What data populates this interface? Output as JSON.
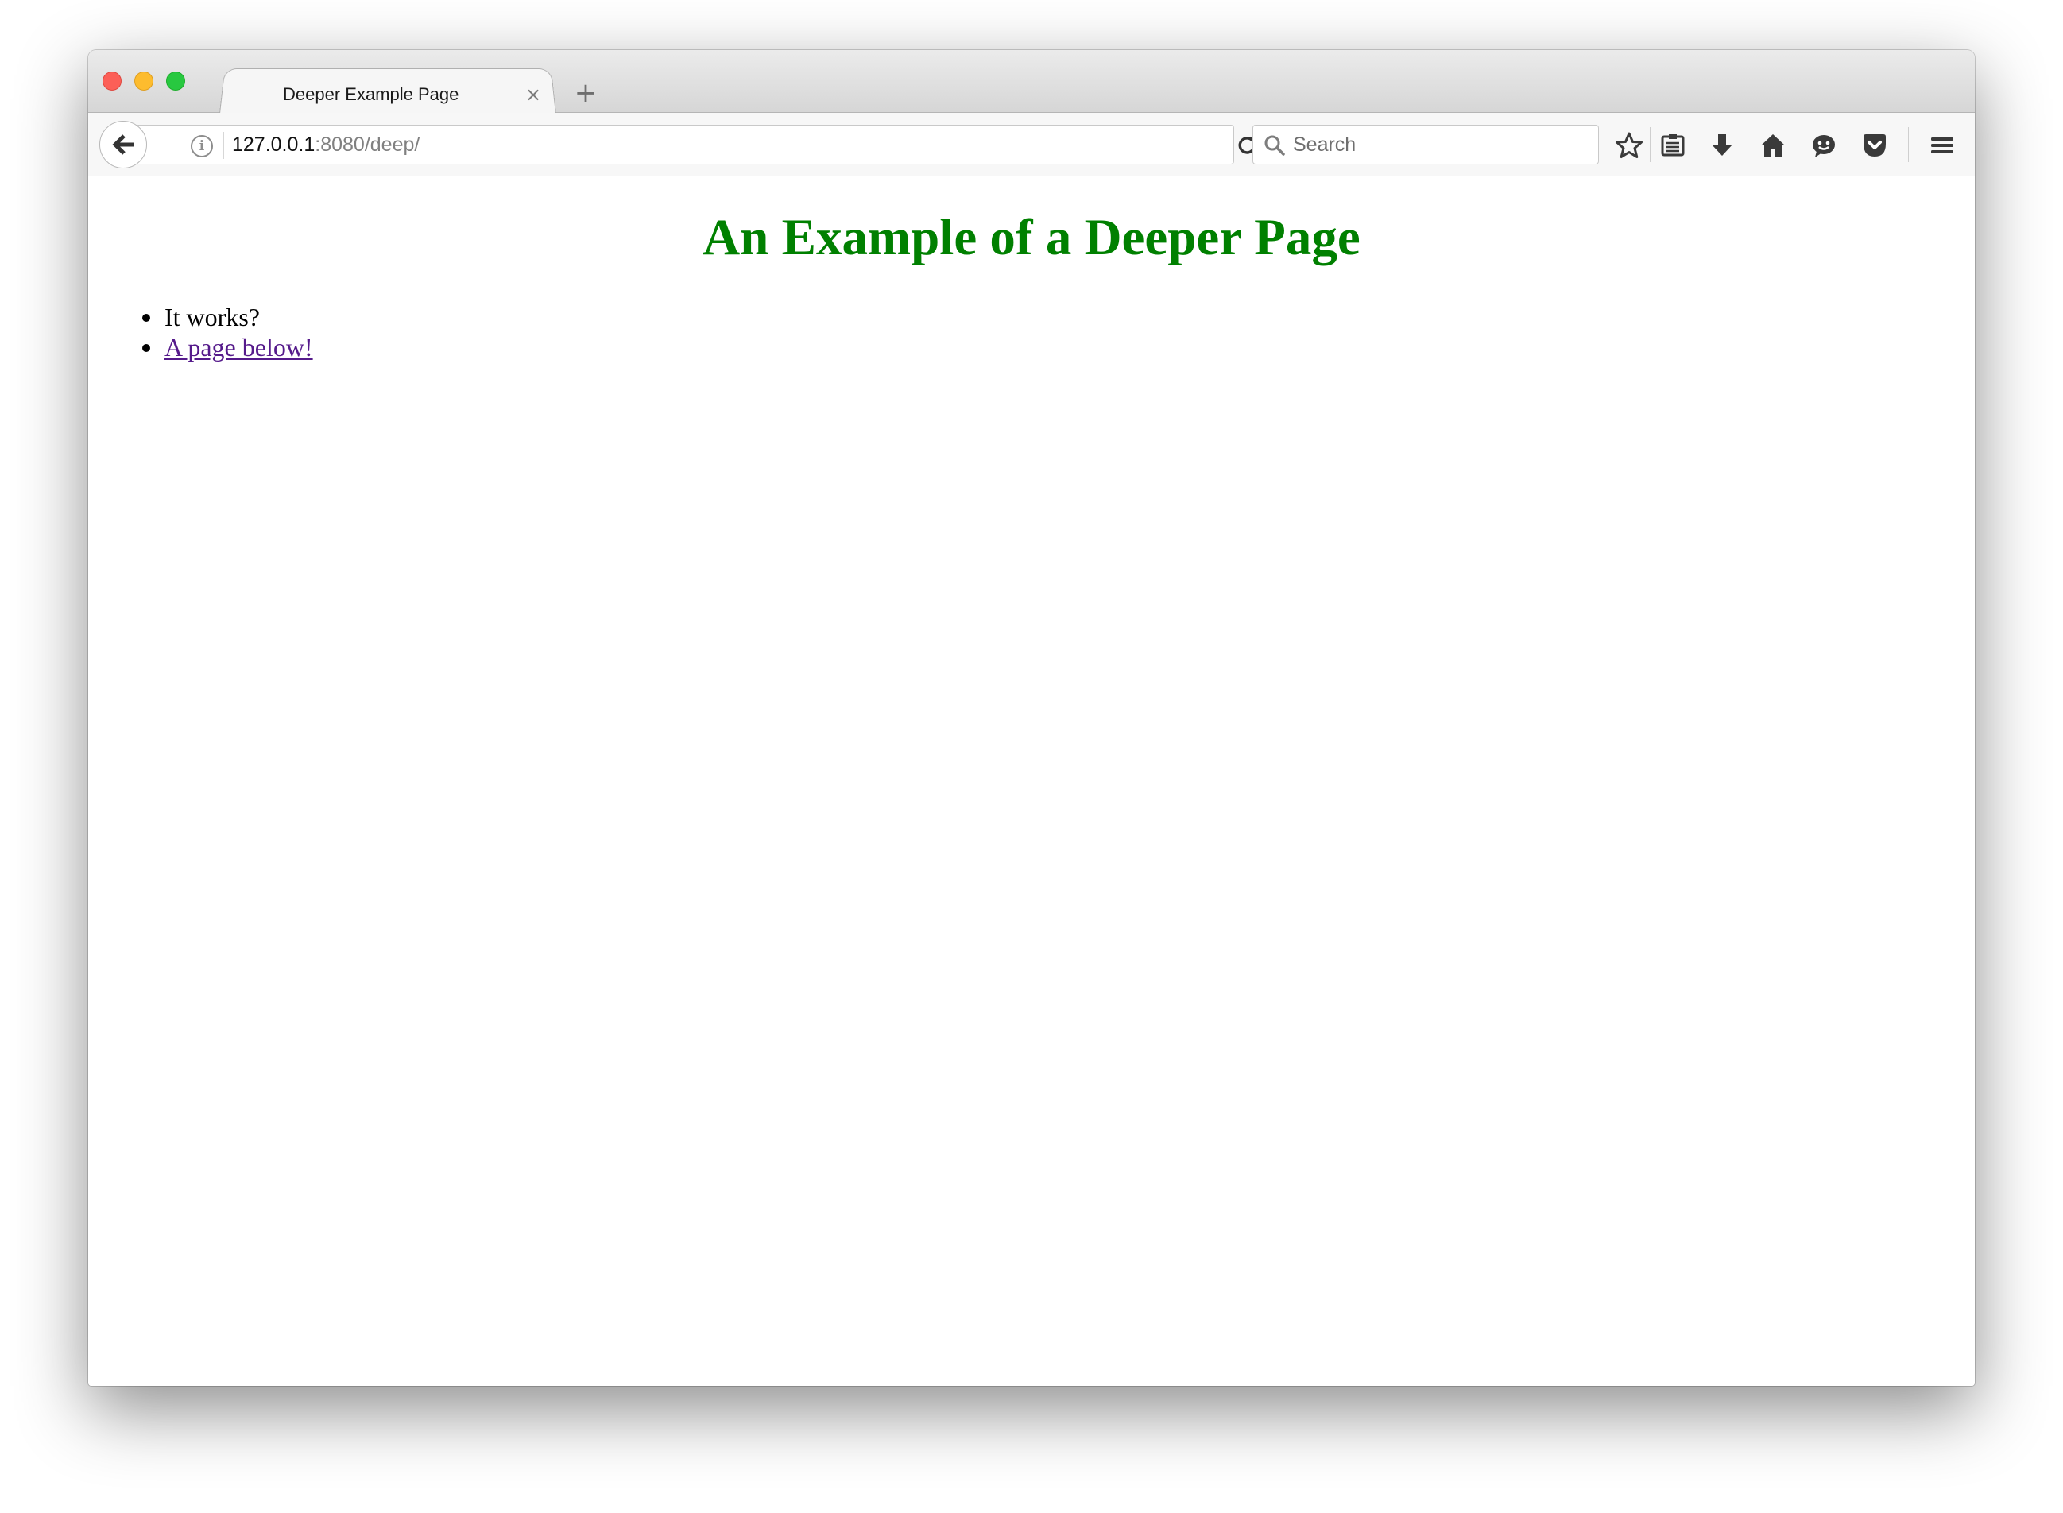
{
  "window": {
    "tab_title": "Deeper Example Page",
    "tab_close": "×",
    "new_tab": "+"
  },
  "toolbar": {
    "url_host": "127.0.0.1",
    "url_rest": ":8080/deep/",
    "search_placeholder": "Search",
    "icons": [
      "back-arrow-icon",
      "info-icon",
      "reload-icon",
      "search-icon",
      "bookmark-star-icon",
      "reading-list-icon",
      "download-icon",
      "home-icon",
      "chat-icon",
      "pocket-icon",
      "hamburger-menu-icon"
    ],
    "info_glyph": "i"
  },
  "page": {
    "heading": "An Example of a Deeper Page",
    "heading_color": "#008000",
    "items": [
      {
        "text": "It works?"
      },
      {
        "link_text": "A page below!"
      }
    ],
    "link_color": "#551a8b"
  }
}
